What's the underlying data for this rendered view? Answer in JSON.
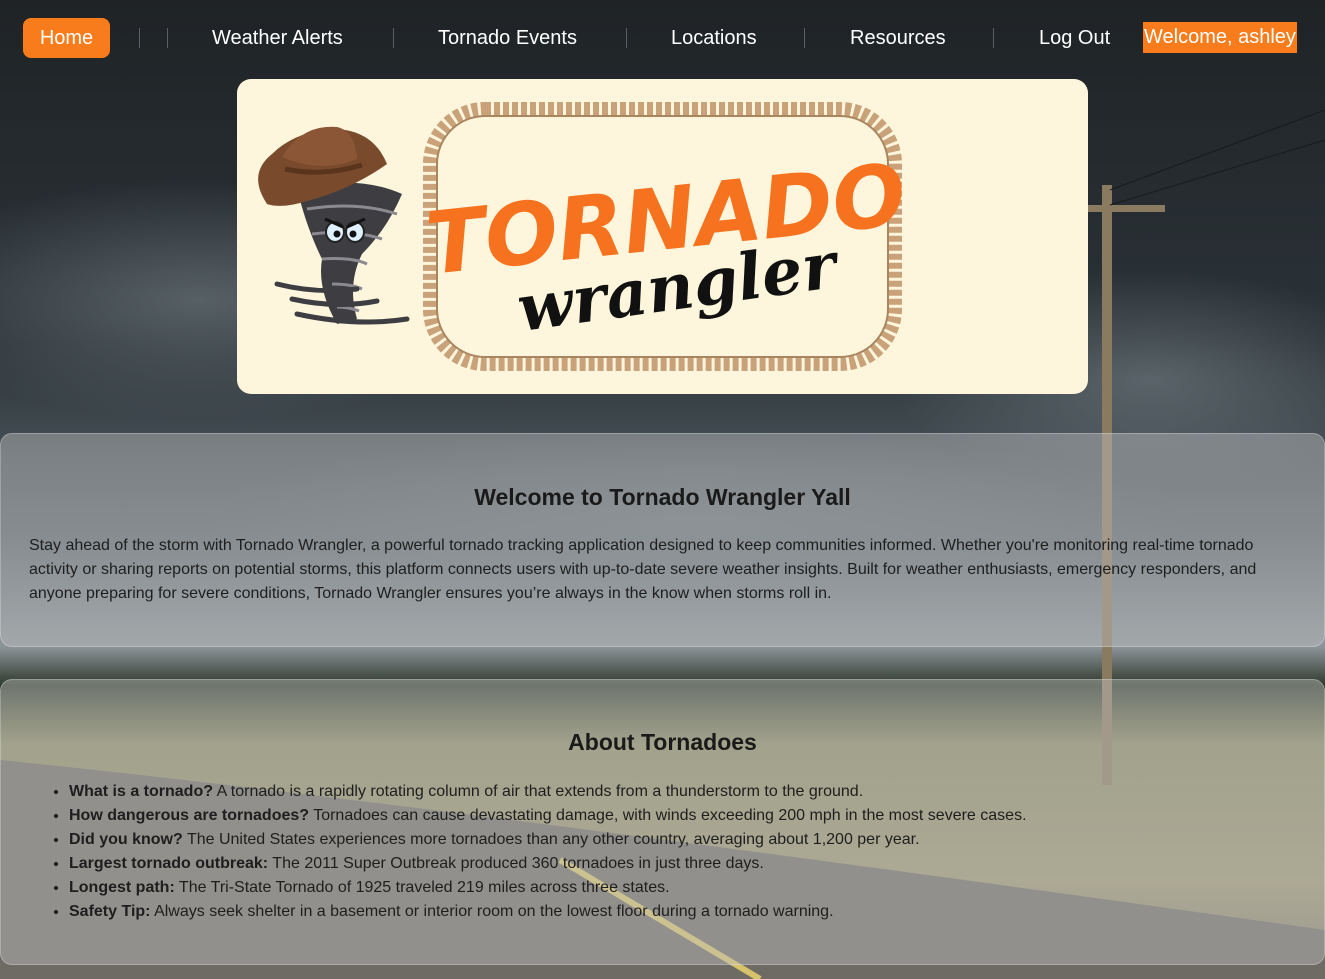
{
  "nav": {
    "home": "Home",
    "weather_alerts": "Weather Alerts",
    "tornado_events": "Tornado Events",
    "locations": "Locations",
    "resources": "Resources",
    "log_out": "Log Out",
    "welcome": "Welcome, ashley"
  },
  "logo": {
    "word_top": "TORNADO",
    "word_bottom": "wrangler"
  },
  "welcome_section": {
    "title": "Welcome to Tornado Wrangler Yall",
    "body": "Stay ahead of the storm with Tornado Wrangler, a powerful tornado tracking application designed to keep communities informed. Whether you're monitoring real-time tornado activity or sharing reports on potential storms, this platform connects users with up-to-date severe weather insights. Built for weather enthusiasts, emergency responders, and anyone preparing for severe conditions, Tornado Wrangler ensures you’re always in the know when storms roll in."
  },
  "about_section": {
    "title": "About Tornadoes",
    "facts": [
      {
        "label": "What is a tornado?",
        "text": " A tornado is a rapidly rotating column of air that extends from a thunderstorm to the ground."
      },
      {
        "label": "How dangerous are tornadoes?",
        "text": " Tornadoes can cause devastating damage, with winds exceeding 200 mph in the most severe cases."
      },
      {
        "label": "Did you know?",
        "text": " The United States experiences more tornadoes than any other country, averaging about 1,200 per year."
      },
      {
        "label": "Largest tornado outbreak:",
        "text": " The 2011 Super Outbreak produced 360 tornadoes in just three days."
      },
      {
        "label": "Longest path:",
        "text": " The Tri-State Tornado of 1925 traveled 219 miles across three states."
      },
      {
        "label": "Safety Tip:",
        "text": " Always seek shelter in a basement or interior room on the lowest floor during a tornado warning."
      }
    ]
  },
  "colors": {
    "accent": "#f97c1c",
    "logo_card": "#fdf6dc",
    "logo_orange": "#f7721f",
    "rope": "#c9a27a"
  }
}
